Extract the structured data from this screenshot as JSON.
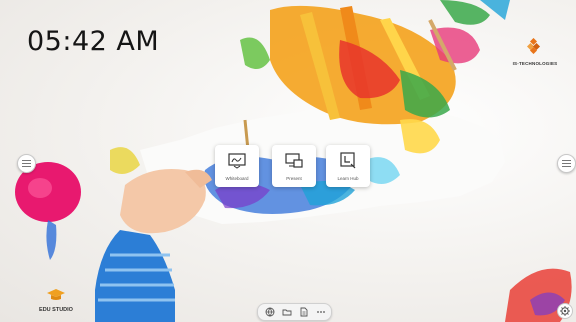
{
  "clock": {
    "time": "05:42 AM"
  },
  "brand": {
    "name": "IS-TECHNOLOGIES",
    "color": "#e8751a"
  },
  "apps": [
    {
      "label": "Whiteboard",
      "icon": "whiteboard-icon"
    },
    {
      "label": "Present",
      "icon": "present-icon"
    },
    {
      "label": "Learn Hub",
      "icon": "learn-hub-icon"
    }
  ],
  "edu": {
    "label": "EDU STUDIO",
    "color": "#f0a020"
  },
  "dock": {
    "buttons": [
      "globe-icon",
      "folder-icon",
      "file-icon",
      "more-icon"
    ]
  },
  "controls": {
    "left_menu": "menu-icon",
    "right_menu": "menu-icon",
    "settings": "gear-icon"
  }
}
